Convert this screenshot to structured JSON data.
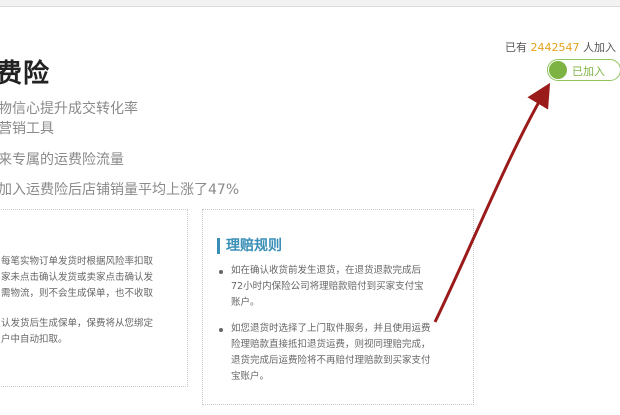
{
  "header": {
    "title": "费险",
    "features": [
      "物信心提升成交转化率",
      "营销工具",
      "来专属的运费险流量",
      "加入运费险后店铺销量平均上涨了47%"
    ]
  },
  "stats": {
    "prefix": "已有",
    "count": "2442547",
    "suffix": "人加入"
  },
  "join_toggle": {
    "label": "已加入",
    "state": "on",
    "accent": "#7cb342"
  },
  "left_box": {
    "lines": [
      "每笔实物订单发货时根据风险率扣取",
      "家未点击确认发货或卖家点击确认发",
      "需物流，则不会生成保单，也不收取",
      "认发货后生成保单，保费将从您绑定",
      "户中自动扣取。"
    ]
  },
  "rules": {
    "title": "理赔规则",
    "items": [
      [
        "如在确认收货前发生退货，在退货退款完成后",
        "72小时内保险公司将理赔款赔付到买家支付宝",
        "账户。"
      ],
      [
        "如您退货时选择了上门取件服务，并且使用运费",
        "险理赔款直接抵扣退货运费，则视同理赔完成，",
        "退货完成后运费险将不再赔付理赔款到买家支付",
        "宝账户。"
      ]
    ]
  },
  "colors": {
    "annotation_arrow": "#9b1b1b",
    "rules_title": "#3a8fb7",
    "count": "#e5a21b"
  }
}
